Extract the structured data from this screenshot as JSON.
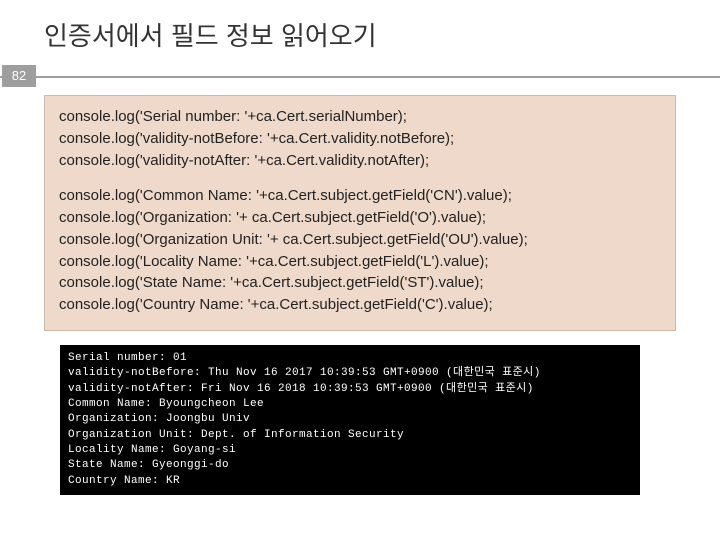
{
  "title": "인증서에서 필드 정보 읽어오기",
  "page_number": "82",
  "code": {
    "block1": [
      "console.log('Serial number: '+ca.Cert.serialNumber);",
      "console.log('validity-notBefore: '+ca.Cert.validity.notBefore);",
      "console.log('validity-notAfter: '+ca.Cert.validity.notAfter);"
    ],
    "block2": [
      "console.log('Common Name: '+ca.Cert.subject.getField('CN').value);",
      "console.log('Organization: '+ ca.Cert.subject.getField('O').value);",
      "console.log('Organization Unit: '+ ca.Cert.subject.getField('OU').value);",
      "console.log('Locality Name: '+ca.Cert.subject.getField('L').value);",
      "console.log('State Name: '+ca.Cert.subject.getField('ST').value);",
      "console.log('Country Name: '+ca.Cert.subject.getField('C').value);"
    ]
  },
  "terminal": [
    "Serial number: 01",
    "validity-notBefore: Thu Nov 16 2017 10:39:53 GMT+0900 (대한민국 표준시)",
    "validity-notAfter: Fri Nov 16 2018 10:39:53 GMT+0900 (대한민국 표준시)",
    "Common Name: Byoungcheon Lee",
    "Organization: Joongbu Univ",
    "Organization Unit: Dept. of Information Security",
    "Locality Name: Goyang-si",
    "State Name: Gyeonggi-do",
    "Country Name: KR"
  ]
}
